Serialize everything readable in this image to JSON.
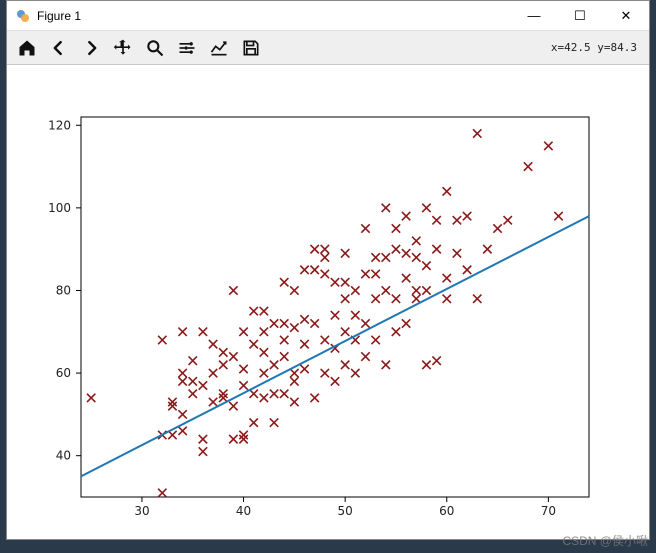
{
  "window": {
    "title": "Figure 1",
    "minimize": "—",
    "maximize": "☐",
    "close": "✕"
  },
  "toolbar": {
    "home": "home",
    "back": "back",
    "forward": "forward",
    "pan": "pan",
    "zoom": "zoom",
    "subplots": "subplots",
    "edit": "edit",
    "save": "save",
    "coord": "x=42.5 y=84.3"
  },
  "watermark": "CSDN @侯小啾",
  "chart_data": {
    "type": "scatter",
    "title": "",
    "xlabel": "",
    "ylabel": "",
    "xlim": [
      24,
      74
    ],
    "ylim": [
      30,
      122
    ],
    "xticks": [
      30,
      40,
      50,
      60,
      70
    ],
    "yticks": [
      40,
      60,
      80,
      100,
      120
    ],
    "series": [
      {
        "name": "points",
        "type": "scatter",
        "marker": "x",
        "color": "#8b1a1a",
        "x": [
          25,
          32,
          32,
          32,
          33,
          33,
          33,
          34,
          34,
          34,
          34,
          34,
          35,
          35,
          35,
          36,
          36,
          36,
          36,
          37,
          37,
          37,
          38,
          38,
          38,
          38,
          39,
          39,
          39,
          39,
          40,
          40,
          40,
          40,
          40,
          41,
          41,
          41,
          41,
          42,
          42,
          42,
          42,
          42,
          43,
          43,
          43,
          43,
          44,
          44,
          44,
          44,
          44,
          45,
          45,
          45,
          45,
          45,
          46,
          46,
          46,
          46,
          47,
          47,
          47,
          47,
          48,
          48,
          48,
          48,
          48,
          49,
          49,
          49,
          49,
          50,
          50,
          50,
          50,
          50,
          51,
          51,
          51,
          51,
          52,
          52,
          52,
          52,
          53,
          53,
          53,
          53,
          54,
          54,
          54,
          54,
          55,
          55,
          55,
          55,
          56,
          56,
          56,
          56,
          57,
          57,
          57,
          57,
          58,
          58,
          58,
          58,
          59,
          59,
          59,
          60,
          60,
          60,
          61,
          61,
          62,
          62,
          63,
          63,
          64,
          65,
          66,
          68,
          70,
          71
        ],
        "y": [
          54,
          31,
          45,
          68,
          45,
          52,
          53,
          58,
          70,
          60,
          50,
          46,
          58,
          55,
          63,
          44,
          41,
          57,
          70,
          53,
          60,
          67,
          55,
          62,
          65,
          54,
          80,
          44,
          52,
          64,
          57,
          44,
          45,
          61,
          70,
          48,
          55,
          67,
          75,
          54,
          60,
          65,
          75,
          70,
          62,
          55,
          48,
          72,
          68,
          72,
          82,
          64,
          55,
          58,
          60,
          71,
          80,
          53,
          61,
          67,
          73,
          85,
          54,
          85,
          90,
          72,
          88,
          68,
          60,
          84,
          90,
          74,
          66,
          82,
          58,
          62,
          78,
          82,
          70,
          89,
          80,
          74,
          60,
          68,
          95,
          84,
          64,
          72,
          78,
          68,
          84,
          88,
          80,
          100,
          88,
          62,
          78,
          70,
          90,
          95,
          98,
          83,
          72,
          89,
          88,
          92,
          78,
          80,
          100,
          86,
          62,
          80,
          63,
          90,
          97,
          78,
          104,
          83,
          97,
          89,
          98,
          85,
          118,
          78,
          90,
          95,
          97,
          110,
          115,
          98
        ]
      },
      {
        "name": "fit",
        "type": "line",
        "color": "#1f77b4",
        "x": [
          24,
          74
        ],
        "y": [
          35,
          98
        ]
      }
    ]
  }
}
